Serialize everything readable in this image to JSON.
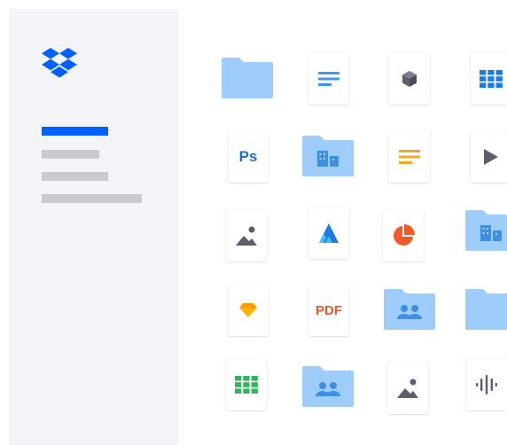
{
  "icons": {
    "ps_label": "Ps",
    "pdf_label": "PDF"
  },
  "colors": {
    "brand_blue": "#0061fe",
    "folder_light": "#9fcdfb",
    "folder_tab": "#8cc2f7",
    "sidebar_bg": "#f3f4f8",
    "nav_inactive": "#c8cacf",
    "doc_blue": "#3d9ae8",
    "ps_blue": "#1c6fc6",
    "note_orange": "#f5a623",
    "chart_red": "#f05a28",
    "sketch_orange": "#fd9a00",
    "pdf_red": "#ea5b2b",
    "sheet_green": "#31b45a",
    "gray_icon": "#5a5f69"
  },
  "file_grid": {
    "icon_names": [
      "folder-icon",
      "document-icon",
      "3d-object-icon",
      "table-icon",
      "photoshop-icon",
      "shared-building-folder-icon",
      "notes-icon",
      "video-play-icon",
      "image-icon",
      "affinity-icon",
      "pie-chart-icon",
      "shared-building-folder-icon",
      "sketch-icon",
      "pdf-icon",
      "shared-people-folder-icon",
      "folder-icon",
      "spreadsheet-icon",
      "shared-people-folder-icon",
      "image-icon",
      "audio-waveform-icon"
    ]
  }
}
